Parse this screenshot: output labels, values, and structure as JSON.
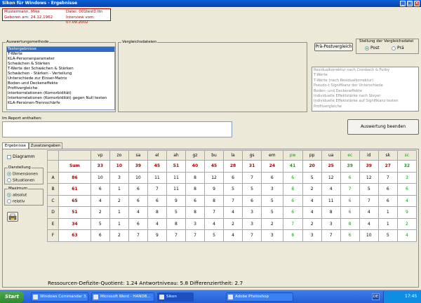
{
  "window": {
    "title": "Sikon für Windows - Ergebnisse"
  },
  "patient": {
    "name": "Mustermann, Mike",
    "birth": "Geboren am: 24.12.1962",
    "file": "Datei: 001test0.ttn",
    "interview": "Interview vom: 07.09.2002"
  },
  "auswertung": {
    "label": "Auswertungsmethode",
    "items": [
      "Testergebnisse",
      "T-Werte",
      "KLA-Personenparameter",
      "Schwächen & Stärken",
      "T-Werte der Schwächen & Stärken",
      "Schwächen - Stärken - Verteilung",
      "Unterschiede zur Einser-Matrix",
      "Boden-und Deckeneffekte",
      "Profilvergleiche",
      "Interkorrelationen (Komorbidität)",
      "Interkorrelationen (Komorbidität) gegen Null testen",
      "KLA-Personen-Trennschärfe"
    ],
    "selected": 0
  },
  "vergleichsdateien": {
    "label": "Vergleichsdateien"
  },
  "prae_post": {
    "label": "Prä-Postvergleich"
  },
  "stellung": {
    "label": "Stellung der Vergleichsdatei",
    "post": "Post",
    "prae": "Prä"
  },
  "methods": {
    "items": [
      "Residualkorrektur nach Cronbach & Furby",
      "T-Werte",
      "T-Werte (nach Residualkorrektur)",
      "Pseudo-t Signifikanz der Unterschiede",
      "Boden- und Deckeneffekte",
      "Individuelle Effektstärke nach Steyer",
      "Individuelle Effektstärke auf Signifikanz testen",
      "Profilvergleiche"
    ]
  },
  "report": {
    "label": "Im Report enthalten:"
  },
  "beenden": {
    "label": "Auswertung beenden"
  },
  "tabs": [
    "Ergebnisse",
    "Zusatzangaben"
  ],
  "side": {
    "diagramm": "Diagramm",
    "darstellung": "Darstellung",
    "dimensionen": "Dimensionen",
    "situationen": "Situationen",
    "maximum": "Maximum",
    "absolut": "absolut",
    "relativ": "relativ"
  },
  "grid": {
    "columns": [
      "vp",
      "zo",
      "sa",
      "el",
      "ah",
      "gz",
      "bu",
      "la",
      "gs",
      "em",
      "pw",
      "pp",
      "ua",
      "ec",
      "id",
      "sk",
      "sc"
    ],
    "green_columns": [
      "pw",
      "ec",
      "sc"
    ],
    "sum_label": "Sum",
    "sum_total": "",
    "sums": [
      "33",
      "10",
      "39",
      "45",
      "51",
      "40",
      "45",
      "28",
      "31",
      "24",
      "41",
      "20",
      "25",
      "39",
      "39",
      "27",
      "32"
    ],
    "rows": [
      {
        "label": "A",
        "total": "86",
        "values": [
          "10",
          "3",
          "10",
          "11",
          "11",
          "8",
          "12",
          "6",
          "7",
          "6",
          "6",
          "5",
          "12",
          "6",
          "12",
          "7",
          "3"
        ]
      },
      {
        "label": "B",
        "total": "61",
        "values": [
          "6",
          "1",
          "6",
          "7",
          "11",
          "8",
          "9",
          "5",
          "5",
          "3",
          "8",
          "2",
          "4",
          "7",
          "5",
          "6",
          "6"
        ]
      },
      {
        "label": "C",
        "total": "65",
        "values": [
          "4",
          "2",
          "6",
          "6",
          "9",
          "6",
          "8",
          "7",
          "6",
          "5",
          "6",
          "4",
          "11",
          "6",
          "7",
          "6",
          "4"
        ]
      },
      {
        "label": "D",
        "total": "51",
        "values": [
          "2",
          "1",
          "4",
          "8",
          "5",
          "8",
          "7",
          "4",
          "3",
          "5",
          "6",
          "4",
          "8",
          "6",
          "4",
          "1",
          "9"
        ]
      },
      {
        "label": "E",
        "total": "34",
        "values": [
          "5",
          "1",
          "6",
          "4",
          "8",
          "3",
          "4",
          "2",
          "3",
          "2",
          "7",
          "2",
          "3",
          "8",
          "4",
          "1",
          "2"
        ]
      },
      {
        "label": "F",
        "total": "63",
        "values": [
          "6",
          "2",
          "7",
          "9",
          "7",
          "7",
          "5",
          "4",
          "7",
          "3",
          "8",
          "3",
          "7",
          "6",
          "10",
          "5",
          "4"
        ]
      }
    ]
  },
  "footer": {
    "text": "Ressourcen-Defizite-Quotient: 1.24  Antwortniveau: 5.8  Differenziertheit: 2.7"
  },
  "taskbar": {
    "start": "Start",
    "tasks": [
      "Windows Commander 3....",
      "Microsoft Word - HANDB...",
      "Sikon",
      "Adobe Photoshop"
    ],
    "active": 2,
    "lang": "DE",
    "time": "17:45"
  }
}
